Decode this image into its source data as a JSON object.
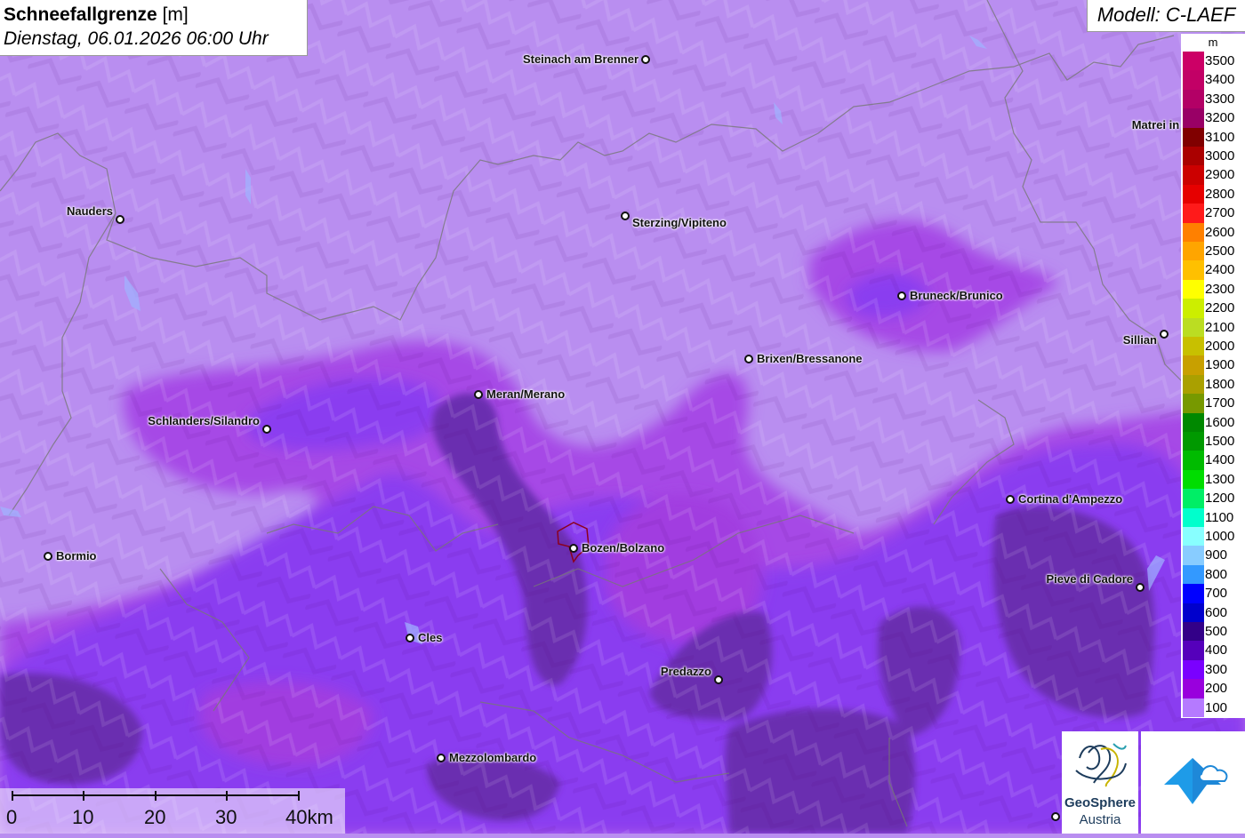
{
  "title": {
    "variable": "Schneefallgrenze",
    "unit": "[m]",
    "datetime": "Dienstag, 06.01.2026 06:00 Uhr"
  },
  "model": "Modell: C-LAEF",
  "legend": {
    "unit": "m",
    "items": [
      {
        "label": "3500",
        "color": "#cc0066"
      },
      {
        "label": "3400",
        "color": "#c20066"
      },
      {
        "label": "3300",
        "color": "#b30066"
      },
      {
        "label": "3200",
        "color": "#990066"
      },
      {
        "label": "3100",
        "color": "#800000"
      },
      {
        "label": "3000",
        "color": "#aa0000"
      },
      {
        "label": "2900",
        "color": "#cc0000"
      },
      {
        "label": "2800",
        "color": "#e60000"
      },
      {
        "label": "2700",
        "color": "#ff1a1a"
      },
      {
        "label": "2600",
        "color": "#ff8000"
      },
      {
        "label": "2500",
        "color": "#ffa500"
      },
      {
        "label": "2400",
        "color": "#ffc000"
      },
      {
        "label": "2300",
        "color": "#ffff00"
      },
      {
        "label": "2200",
        "color": "#ccee00"
      },
      {
        "label": "2100",
        "color": "#bbdd22"
      },
      {
        "label": "2000",
        "color": "#c8c000"
      },
      {
        "label": "1900",
        "color": "#c8a000"
      },
      {
        "label": "1800",
        "color": "#aaa000"
      },
      {
        "label": "1700",
        "color": "#779900"
      },
      {
        "label": "1600",
        "color": "#008800"
      },
      {
        "label": "1500",
        "color": "#009900"
      },
      {
        "label": "1400",
        "color": "#00bb00"
      },
      {
        "label": "1300",
        "color": "#00dd00"
      },
      {
        "label": "1200",
        "color": "#00ee66"
      },
      {
        "label": "1100",
        "color": "#00ffcc"
      },
      {
        "label": "1000",
        "color": "#88ffff"
      },
      {
        "label": "900",
        "color": "#88ccff"
      },
      {
        "label": "800",
        "color": "#3399ff"
      },
      {
        "label": "700",
        "color": "#0000ff"
      },
      {
        "label": "600",
        "color": "#0000cc"
      },
      {
        "label": "500",
        "color": "#330088"
      },
      {
        "label": "400",
        "color": "#5500bb"
      },
      {
        "label": "300",
        "color": "#7a00ff"
      },
      {
        "label": "200",
        "color": "#9900dd"
      },
      {
        "label": "100",
        "color": "#b57aff"
      }
    ]
  },
  "cities": [
    {
      "name": "Steinach am Brenner",
      "dot": [
        726,
        67
      ],
      "label_side": "left"
    },
    {
      "name": "Nauders",
      "dot": [
        135,
        247
      ],
      "label_side": "left-up"
    },
    {
      "name": "Sterzing/Vipiteno",
      "dot": [
        703,
        243
      ],
      "label_side": "right-down"
    },
    {
      "name": "Matrei in Osttirol",
      "dot": [
        1384,
        150
      ],
      "label_side": "left-up"
    },
    {
      "name": "Bruneck/Brunico",
      "dot": [
        1014,
        333
      ],
      "label_side": "right"
    },
    {
      "name": "Sillian",
      "dot": [
        1309,
        376
      ],
      "label_side": "left-down"
    },
    {
      "name": "Brixen/Bressanone",
      "dot": [
        842,
        404
      ],
      "label_side": "right"
    },
    {
      "name": "Meran/Merano",
      "dot": [
        538,
        444
      ],
      "label_side": "right"
    },
    {
      "name": "Schlanders/Silandro",
      "dot": [
        300,
        483
      ],
      "label_side": "left-up"
    },
    {
      "name": "Cortina d'Ampezzo",
      "dot": [
        1136,
        562
      ],
      "label_side": "right"
    },
    {
      "name": "Bormio",
      "dot": [
        54,
        626
      ],
      "label_side": "right"
    },
    {
      "name": "Bozen/Bolzano",
      "dot": [
        645,
        617
      ],
      "label_side": "right"
    },
    {
      "name": "Pieve di Cadore",
      "dot": [
        1282,
        661
      ],
      "label_side": "left-up"
    },
    {
      "name": "Cles",
      "dot": [
        461,
        718
      ],
      "label_side": "right"
    },
    {
      "name": "Predazzo",
      "dot": [
        808,
        765
      ],
      "label_side": "left-up"
    },
    {
      "name": "Mezzolombardo",
      "dot": [
        496,
        853
      ],
      "label_side": "right"
    },
    {
      "name": "",
      "dot": [
        1187,
        919
      ],
      "label_side": "none"
    }
  ],
  "scale": {
    "labels": [
      "0",
      "10",
      "20",
      "30",
      "40km"
    ]
  },
  "logos": {
    "geosphere_line1": "GeoSphere",
    "geosphere_line2": "Austria"
  }
}
